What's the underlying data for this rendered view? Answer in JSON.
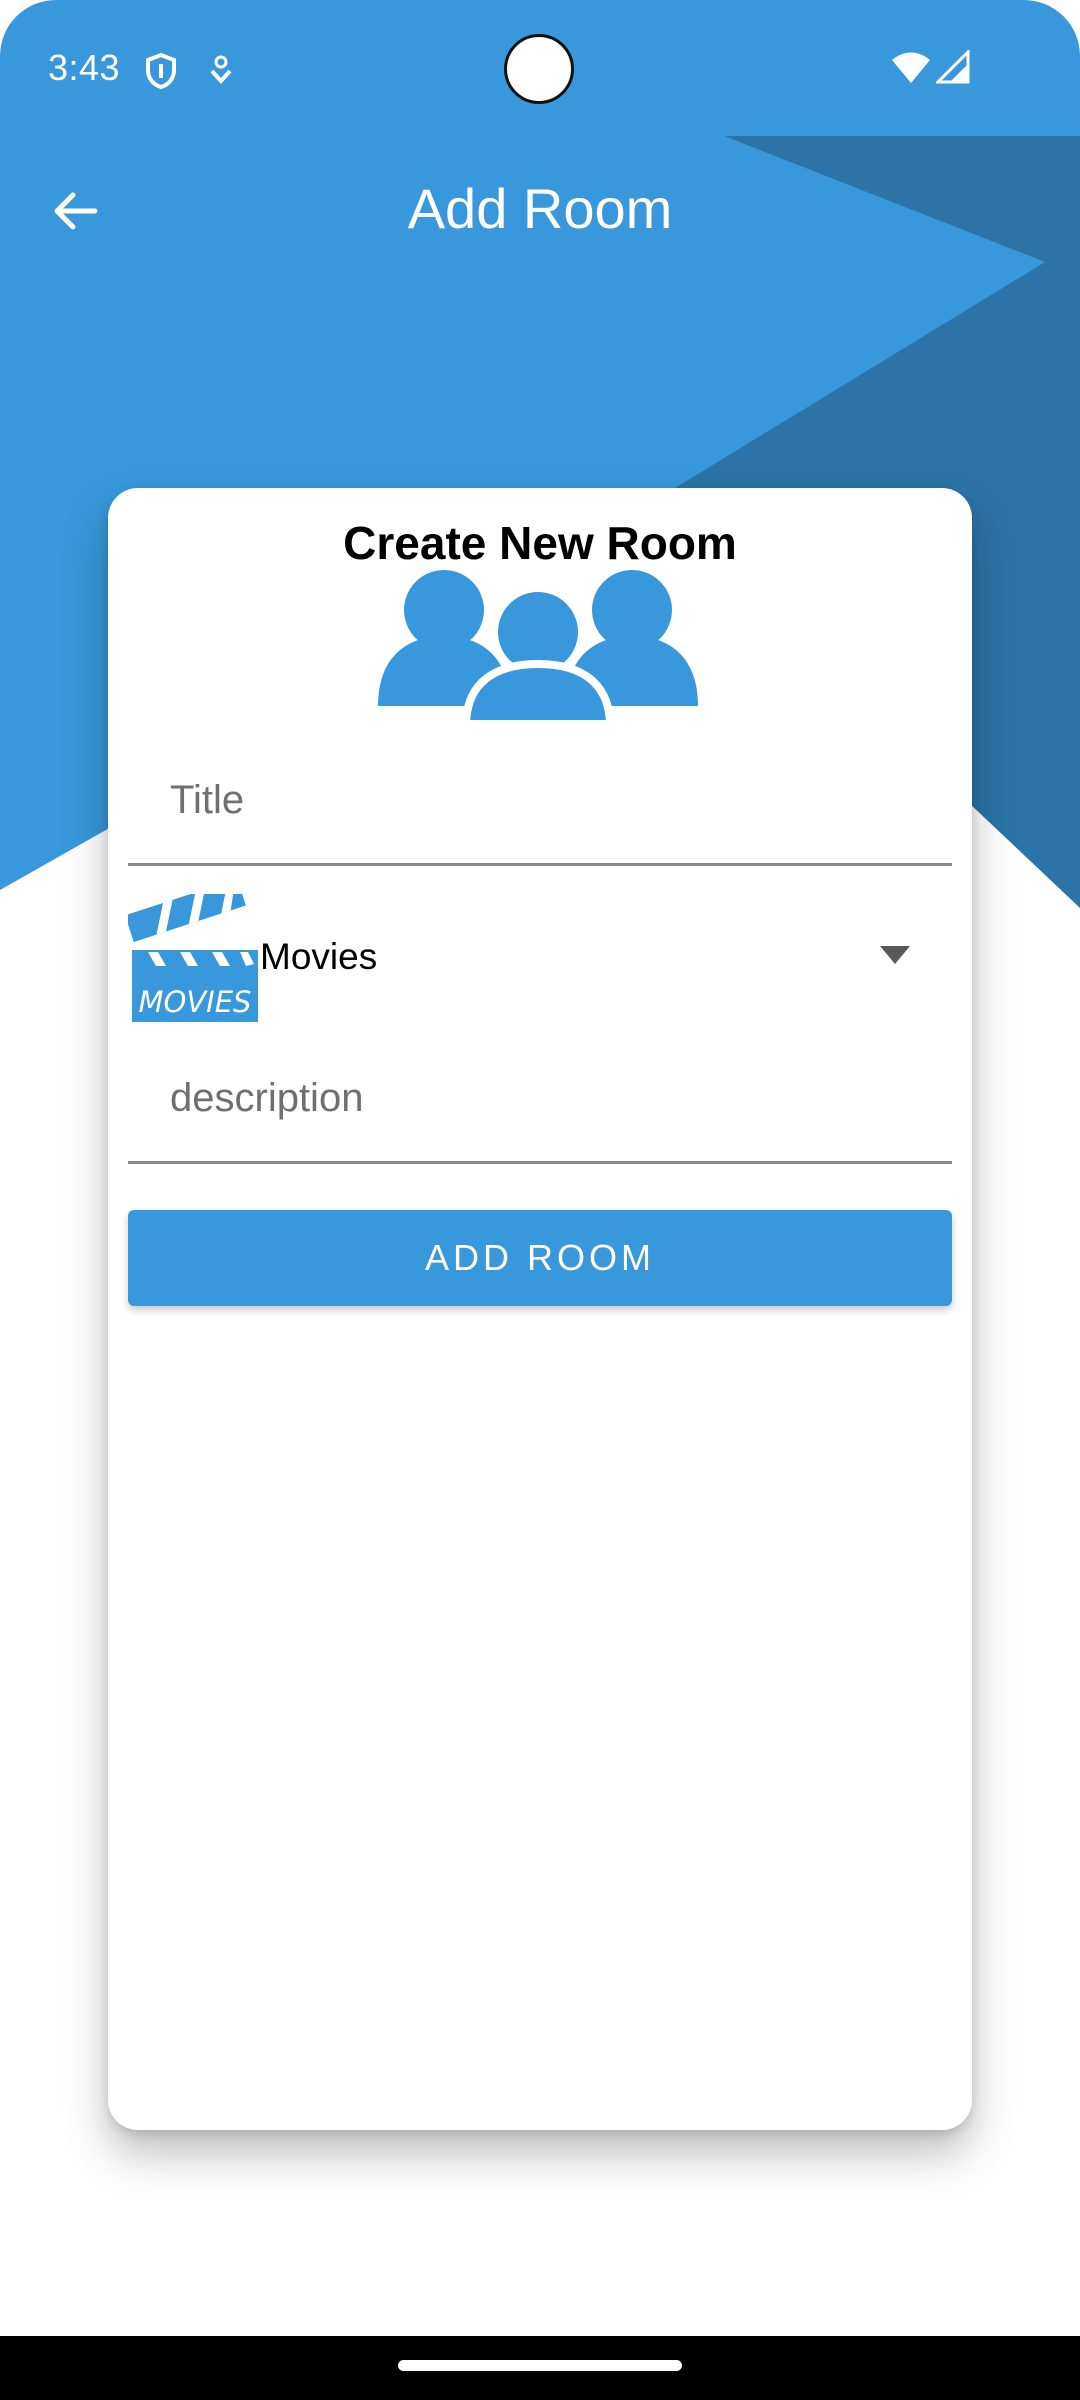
{
  "colors": {
    "primary": "#3898db",
    "primary_dark": "#2c75a8",
    "card": "#ffffff",
    "text": "#000000",
    "hint": "#6f6f6f"
  },
  "status_bar": {
    "time": "3:43",
    "icons": [
      "shield-icon",
      "download-status-icon",
      "wifi-icon",
      "cell-signal-icon"
    ]
  },
  "app_bar": {
    "back_icon": "arrow-left-icon",
    "title": "Add Room"
  },
  "form": {
    "heading": "Create New Room",
    "header_icon": "group-people-icon",
    "title_field": {
      "placeholder": "Title",
      "value": ""
    },
    "category": {
      "icon": "movies-clapperboard-icon",
      "selected": "Movies",
      "arrow_icon": "dropdown-arrow-icon"
    },
    "description_field": {
      "placeholder": "description",
      "value": ""
    },
    "submit_label": "ADD ROOM"
  }
}
